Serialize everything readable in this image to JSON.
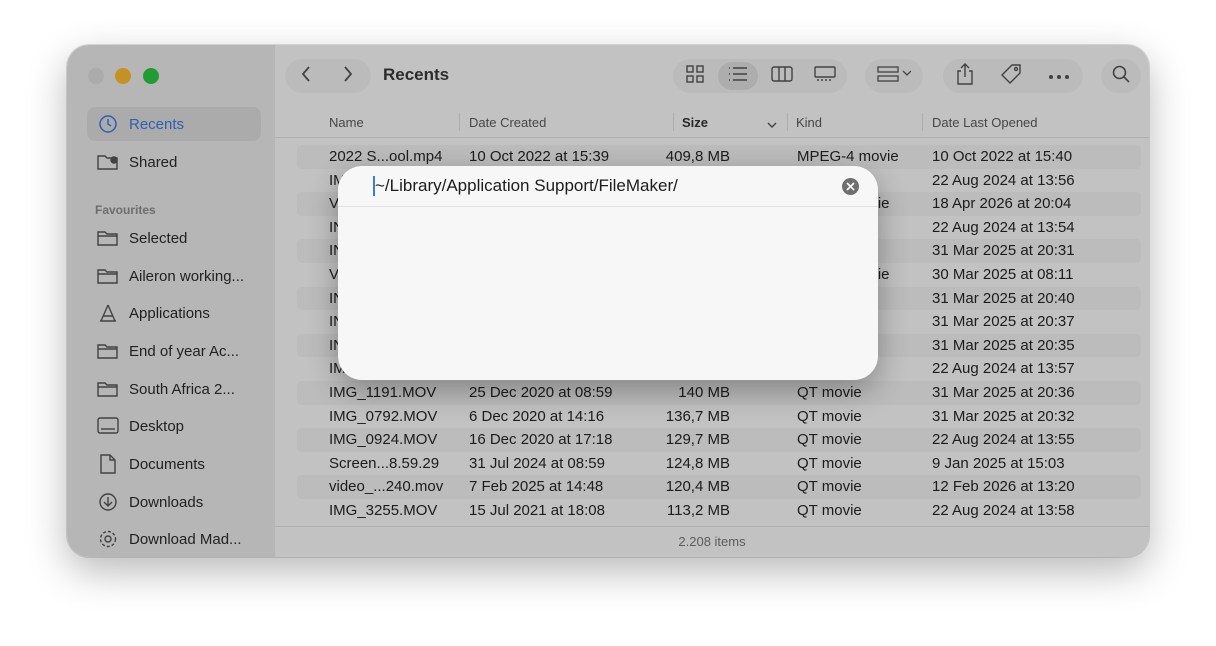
{
  "finder": {
    "title": "Recents",
    "sidebar": {
      "section_header": "Favourites",
      "top_items": [
        {
          "label": "Recents",
          "icon": "clock-icon"
        },
        {
          "label": "Shared",
          "icon": "shared-folder-icon"
        }
      ],
      "favourites": [
        {
          "label": "Selected",
          "icon": "folder-icon"
        },
        {
          "label": "Aileron working...",
          "icon": "folder-icon"
        },
        {
          "label": "Applications",
          "icon": "applications-icon"
        },
        {
          "label": "End of year Ac...",
          "icon": "folder-icon"
        },
        {
          "label": "South Africa 2...",
          "icon": "folder-icon"
        },
        {
          "label": "Desktop",
          "icon": "desktop-icon"
        },
        {
          "label": "Documents",
          "icon": "document-icon"
        },
        {
          "label": "Downloads",
          "icon": "downloads-icon"
        },
        {
          "label": "Download Mad...",
          "icon": "gear-icon"
        }
      ]
    },
    "columns": {
      "name": "Name",
      "created": "Date Created",
      "size": "Size",
      "kind": "Kind",
      "opened": "Date Last Opened"
    },
    "rows": [
      {
        "name": "2022 S...ool.mp4",
        "created": "10 Oct 2022 at 15:39",
        "size": "409,8 MB",
        "kind": "MPEG-4 movie",
        "opened": "10 Oct 2022 at 15:40"
      },
      {
        "name": "IM",
        "created": "",
        "size": "",
        "kind": "",
        "opened": "22 Aug 2024 at 13:56"
      },
      {
        "name": "V",
        "created": "",
        "size": "",
        "kind": "ovie",
        "opened": "18 Apr 2026 at 20:04"
      },
      {
        "name": "IN",
        "created": "",
        "size": "",
        "kind": "",
        "opened": "22 Aug 2024 at 13:54"
      },
      {
        "name": "IN",
        "created": "",
        "size": "",
        "kind": "",
        "opened": "31 Mar 2025 at 20:31"
      },
      {
        "name": "V",
        "created": "",
        "size": "",
        "kind": "ovie",
        "opened": "30 Mar 2025 at 08:11"
      },
      {
        "name": "IN",
        "created": "",
        "size": "",
        "kind": "",
        "opened": "31 Mar 2025 at 20:40"
      },
      {
        "name": "IN",
        "created": "",
        "size": "",
        "kind": "",
        "opened": "31 Mar 2025 at 20:37"
      },
      {
        "name": "IN",
        "created": "",
        "size": "",
        "kind": "",
        "opened": "31 Mar 2025 at 20:35"
      },
      {
        "name": "IM",
        "created": "",
        "size": "",
        "kind": "",
        "opened": "22 Aug 2024 at 13:57"
      },
      {
        "name": "IMG_1191.MOV",
        "created": "25 Dec 2020 at 08:59",
        "size": "140 MB",
        "kind": "QT movie",
        "opened": "31 Mar 2025 at 20:36"
      },
      {
        "name": "IMG_0792.MOV",
        "created": "6 Dec 2020 at 14:16",
        "size": "136,7 MB",
        "kind": "QT movie",
        "opened": "31 Mar 2025 at 20:32"
      },
      {
        "name": "IMG_0924.MOV",
        "created": "16 Dec 2020 at 17:18",
        "size": "129,7 MB",
        "kind": "QT movie",
        "opened": "22 Aug 2024 at 13:55"
      },
      {
        "name": "Screen...8.59.29",
        "created": "31 Jul 2024 at 08:59",
        "size": "124,8 MB",
        "kind": "QT movie",
        "opened": "9 Jan 2025 at 15:03"
      },
      {
        "name": "video_...240.mov",
        "created": "7 Feb 2025 at 14:48",
        "size": "120,4 MB",
        "kind": "QT movie",
        "opened": "12 Feb 2026 at 13:20"
      },
      {
        "name": "IMG_3255.MOV",
        "created": "15 Jul 2021 at 18:08",
        "size": "113,2 MB",
        "kind": "QT movie",
        "opened": "22 Aug 2024 at 13:58"
      }
    ],
    "status": "2.208 items"
  },
  "go_to_folder": {
    "value": "~/Library/Application Support/FileMaker/"
  },
  "colors": {
    "accent": "#3b7be0",
    "minimize": "#fcbc2e",
    "maximize": "#2ac840"
  }
}
